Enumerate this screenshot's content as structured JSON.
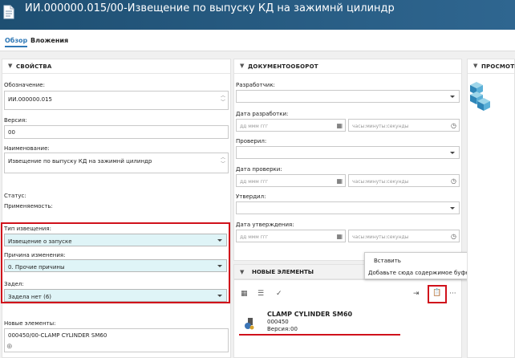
{
  "header": {
    "title": "ИИ.000000.015/00-Извещение по выпуску КД на зажимнй цилиндр"
  },
  "tabs": [
    {
      "label": "Обзор"
    },
    {
      "label": "Вложения"
    }
  ],
  "properties": {
    "title": "СВОЙСТВА",
    "designation_label": "Обозначение:",
    "designation_value": "ИИ.000000.015",
    "version_label": "Версия:",
    "version_value": "00",
    "name_label": "Наименование:",
    "name_value": "Извещение по выпуску КД на зажимнй цилиндр",
    "status_label": "Статус:",
    "applicability_label": "Применяемость:",
    "notice_type_label": "Тип извещения:",
    "notice_type_value": "Извещение о запуске",
    "reason_label": "Причина изменения:",
    "reason_value": "0. Прочие причины",
    "backlog_label": "Задел:",
    "backlog_value": "Задела нет (6)",
    "new_elements_label": "Новые элементы:",
    "new_elements_value": "000450/00-CLAMP CYLINDER SM60"
  },
  "workflow": {
    "title": "ДОКУМЕНТООБОРОТ",
    "developer_label": "Разработчик:",
    "dev_date_label": "Дата разработки:",
    "checker_label": "Проверил:",
    "check_date_label": "Дата проверки:",
    "approver_label": "Утвердил:",
    "approve_date_label": "Дата утверждения:",
    "date_placeholder": "дд ммм ггг",
    "time_placeholder": "часы:минуты:секунды"
  },
  "new_elements": {
    "title": "НОВЫЕ ЭЛЕМЕНТЫ",
    "item": {
      "name": "CLAMP CYLINDER SM60",
      "number": "000450",
      "version_label": "Версия:",
      "version_value": "00"
    }
  },
  "preview": {
    "title": "ПРОСМОТР"
  },
  "context_menu": {
    "paste": "Вставить",
    "paste_hint": "Добавьте сюда содержимое буфера обмена. (Ctrl-V)"
  },
  "colors": {
    "header_bg": "#1e4f72",
    "accent": "#2f78b6",
    "highlight_box": "#d0111b",
    "select_bg": "#dff4f7"
  },
  "icons": [
    "document-icon",
    "calendar-icon",
    "clock-icon",
    "cubes-icon",
    "grid-icon",
    "list-check-icon",
    "check-icon",
    "export-icon",
    "paste-icon",
    "more-icon",
    "part-icon",
    "add-icon"
  ]
}
